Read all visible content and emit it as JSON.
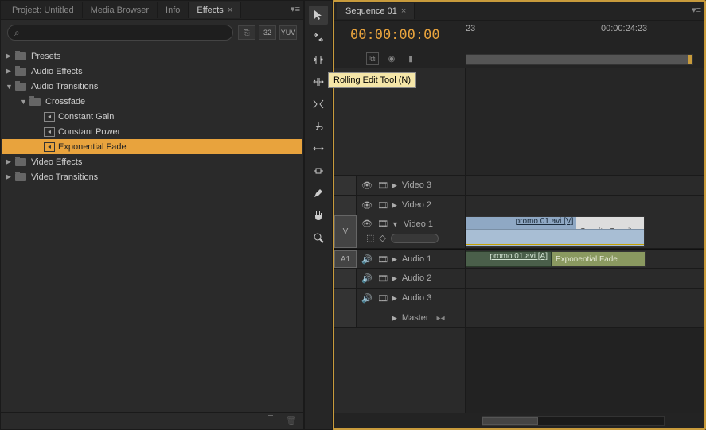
{
  "effects_panel": {
    "tabs": [
      "Project: Untitled",
      "Media Browser",
      "Info",
      "Effects"
    ],
    "active_tab": 3,
    "search_placeholder": "",
    "fx_buttons": [
      "⎘",
      "32",
      "YUV"
    ],
    "tree": [
      {
        "level": 0,
        "expanded": false,
        "type": "folder",
        "label": "Presets"
      },
      {
        "level": 0,
        "expanded": false,
        "type": "folder",
        "label": "Audio Effects"
      },
      {
        "level": 0,
        "expanded": true,
        "type": "folder",
        "label": "Audio Transitions"
      },
      {
        "level": 1,
        "expanded": true,
        "type": "folder",
        "label": "Crossfade"
      },
      {
        "level": 2,
        "expanded": null,
        "type": "preset",
        "label": "Constant Gain"
      },
      {
        "level": 2,
        "expanded": null,
        "type": "preset",
        "label": "Constant Power"
      },
      {
        "level": 2,
        "expanded": null,
        "type": "preset",
        "label": "Exponential Fade",
        "selected": true
      },
      {
        "level": 0,
        "expanded": false,
        "type": "folder",
        "label": "Video Effects"
      },
      {
        "level": 0,
        "expanded": false,
        "type": "folder",
        "label": "Video Transitions"
      }
    ]
  },
  "tools": [
    {
      "name": "selection-tool"
    },
    {
      "name": "track-select-tool"
    },
    {
      "name": "ripple-edit-tool"
    },
    {
      "name": "rolling-edit-tool",
      "tooltip": "Rolling Edit Tool (N)"
    },
    {
      "name": "rate-stretch-tool"
    },
    {
      "name": "razor-tool"
    },
    {
      "name": "slip-tool"
    },
    {
      "name": "slide-tool"
    },
    {
      "name": "pen-tool"
    },
    {
      "name": "hand-tool"
    },
    {
      "name": "zoom-tool"
    }
  ],
  "timeline": {
    "sequence_tab": "Sequence 01",
    "timecode": "00:00:00:00",
    "ruler_ticks": [
      {
        "pos": 0,
        "label": "23"
      },
      {
        "pos": 170,
        "label": "00:00:24:23"
      }
    ],
    "tracks": {
      "video": [
        {
          "name": "Video 3",
          "height": 25
        },
        {
          "name": "Video 2",
          "height": 25
        },
        {
          "name": "Video 1",
          "height": 42,
          "expanded": true,
          "selector": "V"
        }
      ],
      "audio": [
        {
          "name": "Audio 1",
          "height": 25,
          "selector": "A1"
        },
        {
          "name": "Audio 2",
          "height": 25
        },
        {
          "name": "Audio 3",
          "height": 25
        }
      ],
      "master": {
        "name": "Master",
        "height": 25
      }
    },
    "clips": {
      "video1": {
        "label": "promo 01.avi [V]",
        "opacity_label": "Opacity:Opacity"
      },
      "audio1": {
        "label": "promo 01.avi [A]"
      },
      "transition": {
        "label": "Exponential Fade"
      }
    }
  }
}
